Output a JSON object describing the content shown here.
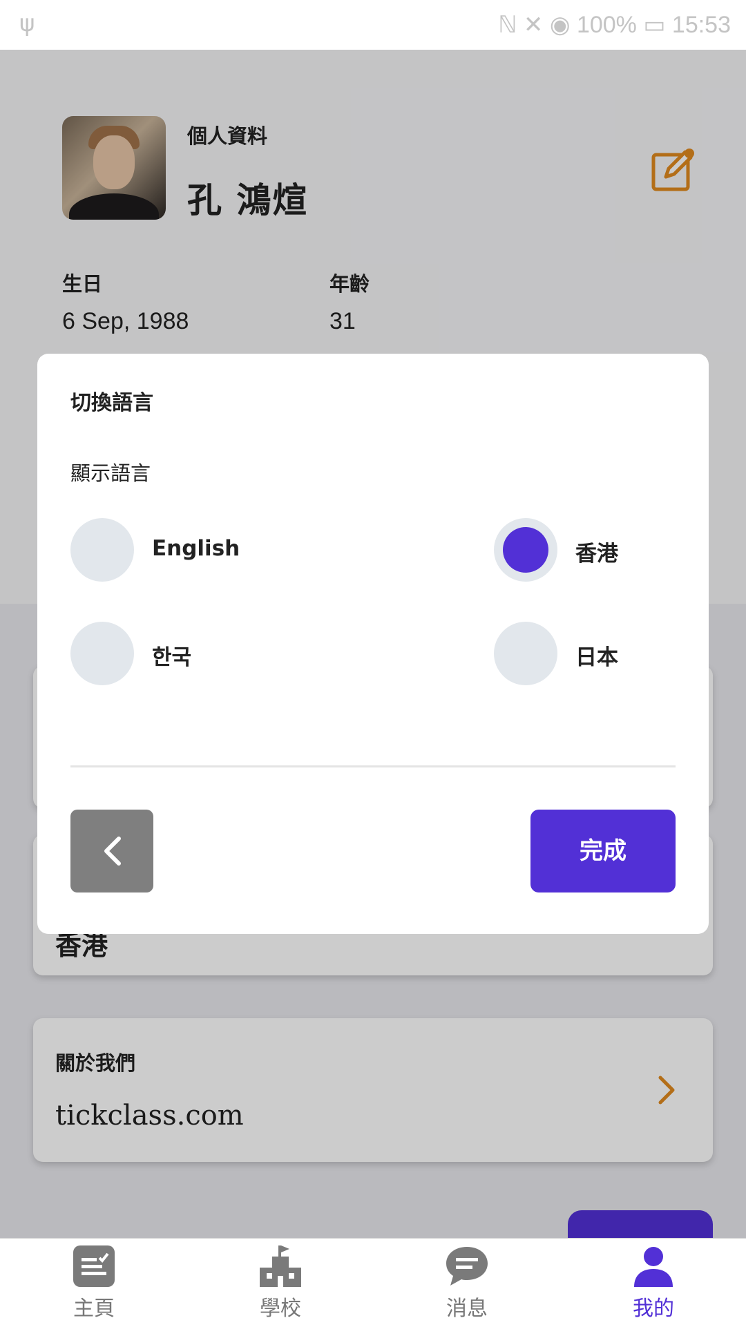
{
  "status_bar": {
    "left_glyph": "ψ",
    "right_text": "ℕ ✕ ◉ 100% ▭ 15:53"
  },
  "profile": {
    "heading": "個人資料",
    "name": "孔 鴻煊",
    "dob_label": "生日",
    "dob_value": "6 Sep, 1988",
    "age_label": "年齡",
    "age_value": "31",
    "accent_color": "#e08a1e"
  },
  "cards": {
    "language_value": "香港",
    "about_title": "關於我們",
    "about_value": "tickclass.com"
  },
  "dialog": {
    "title": "切換語言",
    "subtitle": "顯示語言",
    "options": [
      {
        "label": "English",
        "selected": false
      },
      {
        "label": "香港",
        "selected": true
      },
      {
        "label": "한국",
        "selected": false
      },
      {
        "label": "日本",
        "selected": false
      }
    ],
    "back_icon": "chevron-left-icon",
    "done_label": "完成",
    "primary_color": "#5230d6"
  },
  "bottom_nav": [
    {
      "label": "主頁",
      "icon": "home-icon",
      "active": false
    },
    {
      "label": "學校",
      "icon": "school-icon",
      "active": false
    },
    {
      "label": "消息",
      "icon": "message-icon",
      "active": false
    },
    {
      "label": "我的",
      "icon": "profile-icon",
      "active": true
    }
  ]
}
